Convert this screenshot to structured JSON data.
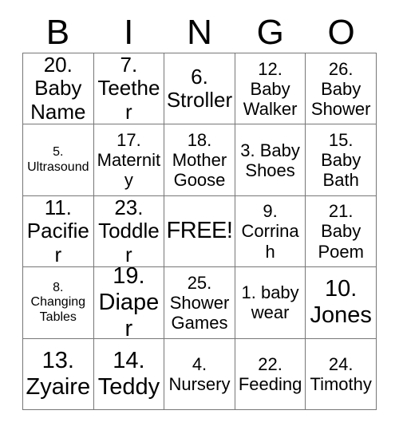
{
  "card": {
    "headers": [
      "B",
      "I",
      "N",
      "G",
      "O"
    ],
    "free_space_label": "FREE!",
    "border_color": "#777777",
    "text_color": "#000000",
    "background_color": "#ffffff",
    "rows": [
      [
        {
          "text": "20. Baby Name",
          "number": "20",
          "label": "Baby Name",
          "size": "lg"
        },
        {
          "text": "7. Teether",
          "number": "7",
          "label": "Teether",
          "size": "lg"
        },
        {
          "text": "6. Stroller",
          "number": "6",
          "label": "Stroller",
          "size": "lg"
        },
        {
          "text": "12. Baby Walker",
          "number": "12",
          "label": "Baby Walker",
          "size": "md"
        },
        {
          "text": "26. Baby Shower",
          "number": "26",
          "label": "Baby Shower",
          "size": "md"
        }
      ],
      [
        {
          "text": "5. Ultrasound",
          "number": "5",
          "label": "Ultrasound",
          "size": "sm"
        },
        {
          "text": "17. Maternity",
          "number": "17",
          "label": "Maternity",
          "size": "md"
        },
        {
          "text": "18. Mother Goose",
          "number": "18",
          "label": "Mother Goose",
          "size": "md"
        },
        {
          "text": "3. Baby Shoes",
          "number": "3",
          "label": "Baby Shoes",
          "size": "md"
        },
        {
          "text": "15. Baby Bath",
          "number": "15",
          "label": "Baby Bath",
          "size": "md"
        }
      ],
      [
        {
          "text": "11. Pacifier",
          "number": "11",
          "label": "Pacifier",
          "size": "lg"
        },
        {
          "text": "23. Toddler",
          "number": "23",
          "label": "Toddler",
          "size": "lg"
        },
        {
          "text": "FREE!",
          "number": "",
          "label": "FREE!",
          "size": "free"
        },
        {
          "text": "9. Corrinah",
          "number": "9",
          "label": "Corrinah",
          "size": "md"
        },
        {
          "text": "21. Baby Poem",
          "number": "21",
          "label": "Baby Poem",
          "size": "md"
        }
      ],
      [
        {
          "text": "8. Changing Tables",
          "number": "8",
          "label": "Changing Tables",
          "size": "sm"
        },
        {
          "text": "19. Diaper",
          "number": "19",
          "label": "Diaper",
          "size": "xl"
        },
        {
          "text": "25. Shower Games",
          "number": "25",
          "label": "Shower Games",
          "size": "md"
        },
        {
          "text": "1. baby wear",
          "number": "1",
          "label": "baby wear",
          "size": "md"
        },
        {
          "text": "10. Jones",
          "number": "10",
          "label": "Jones",
          "size": "xl"
        }
      ],
      [
        {
          "text": "13. Zyaire",
          "number": "13",
          "label": "Zyaire",
          "size": "xl"
        },
        {
          "text": "14. Teddy",
          "number": "14",
          "label": "Teddy",
          "size": "xl"
        },
        {
          "text": "4. Nursery",
          "number": "4",
          "label": "Nursery",
          "size": "md"
        },
        {
          "text": "22. Feeding",
          "number": "22",
          "label": "Feeding",
          "size": "md"
        },
        {
          "text": "24. Timothy",
          "number": "24",
          "label": "Timothy",
          "size": "md"
        }
      ]
    ]
  }
}
